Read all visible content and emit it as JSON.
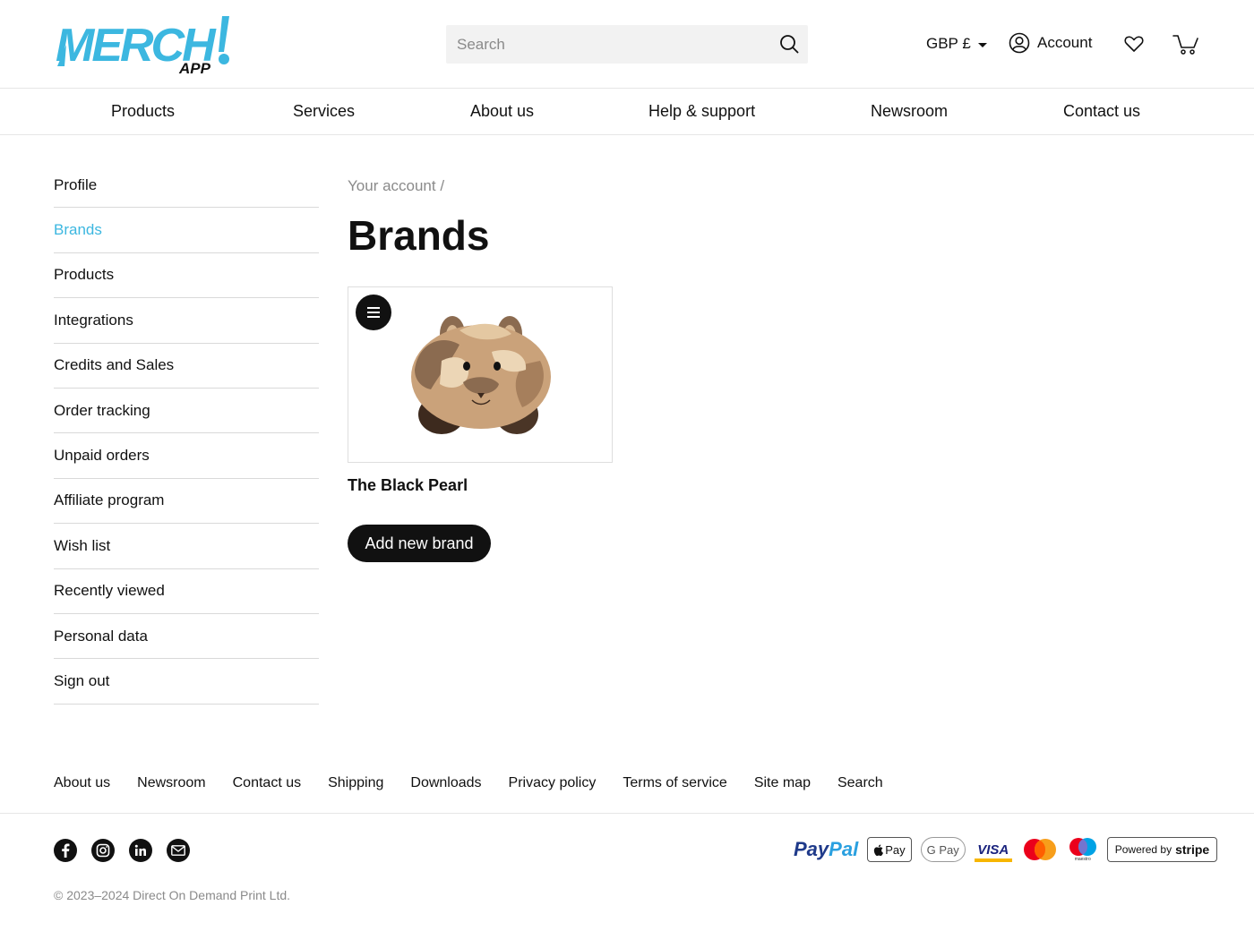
{
  "header": {
    "logo": {
      "main": "MERCH",
      "sub": "APP",
      "color": "#3cb7e0"
    },
    "search": {
      "placeholder": "Search",
      "icon": "search-icon"
    },
    "currency": "GBP £",
    "account_label": "Account",
    "wishlist_icon": "heart-icon",
    "cart_icon": "cart-icon"
  },
  "nav": [
    "Products",
    "Services",
    "About us",
    "Help & support",
    "Newsroom",
    "Contact us"
  ],
  "sidebar": {
    "active": "Brands",
    "accent": "#3cb7e0",
    "items": [
      "Profile",
      "Brands",
      "Products",
      "Integrations",
      "Credits and Sales",
      "Order tracking",
      "Unpaid orders",
      "Affiliate program",
      "Wish list",
      "Recently viewed",
      "Personal data",
      "Sign out"
    ]
  },
  "main": {
    "breadcrumb": "Your account  /",
    "title": "Brands",
    "brands": [
      {
        "name": "The Black Pearl",
        "image": "hamster-illustration",
        "menu_icon": "hamburger-menu-icon"
      }
    ],
    "add_button": "Add new brand"
  },
  "footer": {
    "links": [
      "About us",
      "Newsroom",
      "Contact us",
      "Shipping",
      "Downloads",
      "Privacy policy",
      "Terms of service",
      "Site map",
      "Search"
    ],
    "socials": [
      "facebook-icon",
      "instagram-icon",
      "linkedin-icon",
      "email-icon"
    ],
    "payments": {
      "paypal_a": "Pay",
      "paypal_b": "Pal",
      "apple_pay": "Pay",
      "google_pay": "G Pay",
      "visa": "VISA",
      "maestro": "maestro",
      "stripe_prefix": "Powered by",
      "stripe_brand": "stripe"
    },
    "copyright": "© 2023–2024 Direct On Demand Print Ltd."
  }
}
